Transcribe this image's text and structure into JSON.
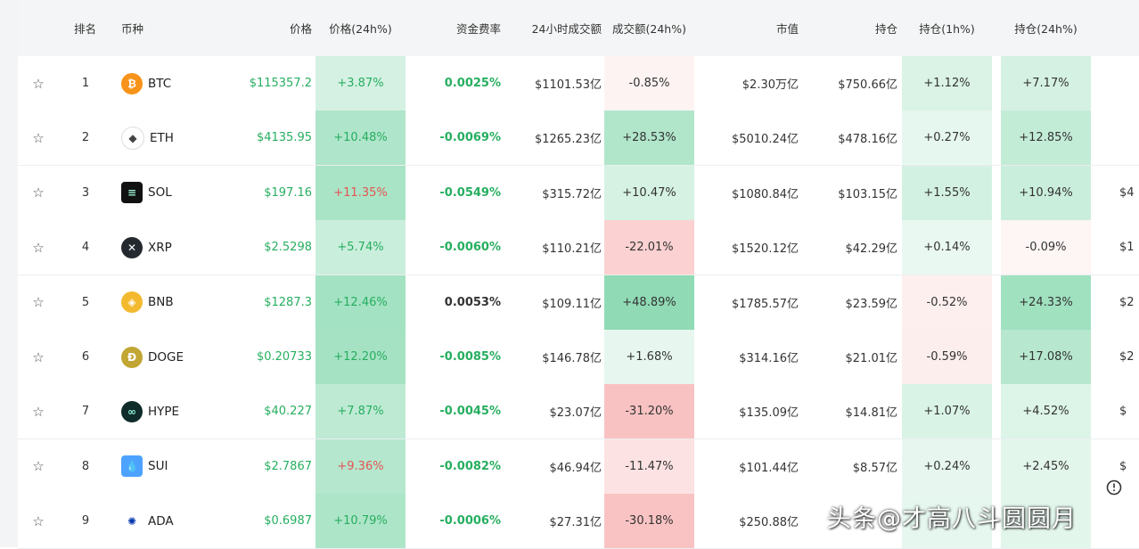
{
  "header": {
    "rank": "排名",
    "coin": "币种",
    "price": "价格",
    "price_change": "价格(24h%)",
    "funding_rate": "资金费率",
    "volume_24h": "24小时成交额",
    "volume_change": "成交额(24h%)",
    "market_cap": "市值",
    "open_interest": "持仓",
    "oi_1h": "持仓(1h%)",
    "oi_24h": "持仓(24h%)"
  },
  "colors": {
    "green_text": "#27ae60",
    "red_text": "#e25555"
  },
  "rows": [
    {
      "rank": "1",
      "coin": "BTC",
      "icon": "bitcoin-icon",
      "price": "$115357.2",
      "price_change": "+3.87%",
      "funding": "0.0025%",
      "volume": "$1101.53亿",
      "volume_change": "-0.85%",
      "mcap": "$2.30万亿",
      "oi": "$750.66亿",
      "oi1h": "+1.12%",
      "oi24h": "+7.17%",
      "extra": ""
    },
    {
      "rank": "2",
      "coin": "ETH",
      "icon": "ethereum-icon",
      "price": "$4135.95",
      "price_change": "+10.48%",
      "funding": "-0.0069%",
      "volume": "$1265.23亿",
      "volume_change": "+28.53%",
      "mcap": "$5010.24亿",
      "oi": "$478.16亿",
      "oi1h": "+0.27%",
      "oi24h": "+12.85%",
      "extra": ""
    },
    {
      "rank": "3",
      "coin": "SOL",
      "icon": "solana-icon",
      "price": "$197.16",
      "price_change": "+11.35%",
      "funding": "-0.0549%",
      "volume": "$315.72亿",
      "volume_change": "+10.47%",
      "mcap": "$1080.84亿",
      "oi": "$103.15亿",
      "oi1h": "+1.55%",
      "oi24h": "+10.94%",
      "extra": "$4"
    },
    {
      "rank": "4",
      "coin": "XRP",
      "icon": "xrp-icon",
      "price": "$2.5298",
      "price_change": "+5.74%",
      "funding": "-0.0060%",
      "volume": "$110.21亿",
      "volume_change": "-22.01%",
      "mcap": "$1520.12亿",
      "oi": "$42.29亿",
      "oi1h": "+0.14%",
      "oi24h": "-0.09%",
      "extra": "$1"
    },
    {
      "rank": "5",
      "coin": "BNB",
      "icon": "bnb-icon",
      "price": "$1287.3",
      "price_change": "+12.46%",
      "funding": "0.0053%",
      "volume": "$109.11亿",
      "volume_change": "+48.89%",
      "mcap": "$1785.57亿",
      "oi": "$23.59亿",
      "oi1h": "-0.52%",
      "oi24h": "+24.33%",
      "extra": "$2"
    },
    {
      "rank": "6",
      "coin": "DOGE",
      "icon": "doge-icon",
      "price": "$0.20733",
      "price_change": "+12.20%",
      "funding": "-0.0085%",
      "volume": "$146.78亿",
      "volume_change": "+1.68%",
      "mcap": "$314.16亿",
      "oi": "$21.01亿",
      "oi1h": "-0.59%",
      "oi24h": "+17.08%",
      "extra": "$2"
    },
    {
      "rank": "7",
      "coin": "HYPE",
      "icon": "hype-icon",
      "price": "$40.227",
      "price_change": "+7.87%",
      "funding": "-0.0045%",
      "volume": "$23.07亿",
      "volume_change": "-31.20%",
      "mcap": "$135.09亿",
      "oi": "$14.81亿",
      "oi1h": "+1.07%",
      "oi24h": "+4.52%",
      "extra": "$"
    },
    {
      "rank": "8",
      "coin": "SUI",
      "icon": "sui-icon",
      "price": "$2.7867",
      "price_change": "+9.36%",
      "funding": "-0.0082%",
      "volume": "$46.94亿",
      "volume_change": "-11.47%",
      "mcap": "$101.44亿",
      "oi": "$8.57亿",
      "oi1h": "+0.24%",
      "oi24h": "+2.45%",
      "extra": "$"
    },
    {
      "rank": "9",
      "coin": "ADA",
      "icon": "cardano-icon",
      "price": "$0.6987",
      "price_change": "+10.79%",
      "funding": "-0.0006%",
      "volume": "$27.31亿",
      "volume_change": "-30.18%",
      "mcap": "$250.88亿",
      "oi": "",
      "oi1h": "",
      "oi24h": "",
      "extra": ""
    }
  ],
  "watermark": "头条@才高八斗圆圆月"
}
